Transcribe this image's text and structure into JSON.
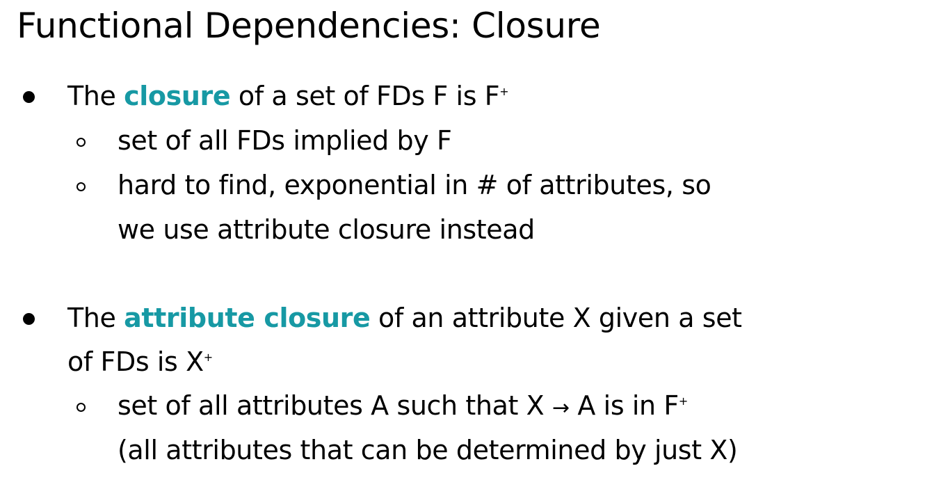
{
  "slide": {
    "title": "Functional Dependencies: Closure",
    "accent_color": "#1799a4",
    "bullet1": {
      "pre": "The ",
      "term": "closure",
      "post": " of a set of FDs F is F",
      "sup": "+",
      "subs": [
        {
          "line1": "set of all FDs implied by F"
        },
        {
          "line1": "hard to find, exponential in # of attributes, so",
          "line2": "we use attribute closure instead"
        }
      ]
    },
    "bullet2": {
      "pre": "The ",
      "term": "attribute closure",
      "post": " of an attribute X given a set",
      "line2": "of FDs is X",
      "line2_sup": "+",
      "sub": {
        "line1_pre": "set of all attributes A such that X ",
        "arrow": "→",
        "line1_post": " A is in F",
        "line1_sup": "+",
        "line2": "(all attributes that can be determined by just X)"
      }
    }
  }
}
